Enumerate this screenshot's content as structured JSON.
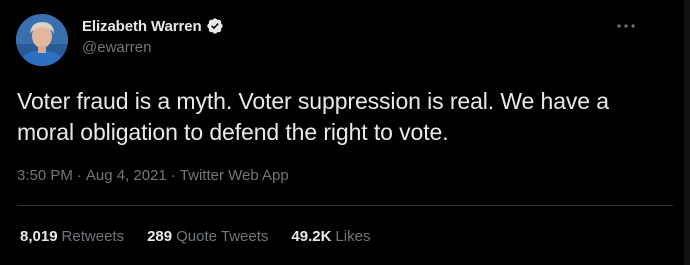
{
  "author": {
    "display_name": "Elizabeth Warren",
    "handle": "@ewarren",
    "verified_icon": "verified-badge-icon",
    "avatar_icon": "profile-avatar"
  },
  "tweet": {
    "text": "Voter fraud is a myth. Voter suppression is real. We have a moral obligation to defend the right to vote."
  },
  "meta": {
    "time": "3:50 PM",
    "separator": "·",
    "date": "Aug 4, 2021",
    "source": "Twitter Web App"
  },
  "stats": [
    {
      "value": "8,019",
      "label": "Retweets"
    },
    {
      "value": "289",
      "label": "Quote Tweets"
    },
    {
      "value": "49.2K",
      "label": "Likes"
    }
  ],
  "colors": {
    "background": "#000000",
    "primary_text": "#e7e9ea",
    "secondary_text": "#71767b",
    "divider": "#2f3336"
  }
}
